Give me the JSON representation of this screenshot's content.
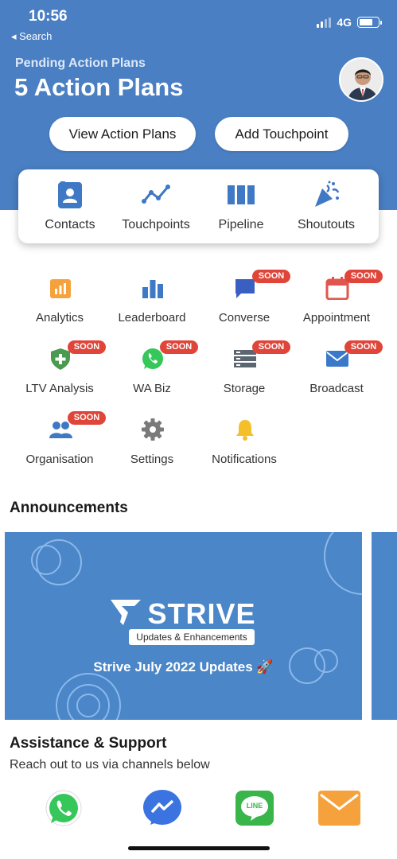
{
  "status_bar": {
    "time": "10:56",
    "back_label": "◂ Search",
    "network": "4G"
  },
  "header": {
    "pending_label": "Pending Action Plans",
    "pending_title": "5 Action Plans",
    "view_button": "View Action Plans",
    "add_button": "Add Touchpoint"
  },
  "quick_actions": [
    {
      "label": "Contacts",
      "icon": "contacts-icon"
    },
    {
      "label": "Touchpoints",
      "icon": "touchpoints-icon"
    },
    {
      "label": "Pipeline",
      "icon": "pipeline-icon"
    },
    {
      "label": "Shoutouts",
      "icon": "shoutouts-icon"
    }
  ],
  "soon_label": "SOON",
  "features": [
    {
      "label": "Analytics",
      "icon": "analytics-icon",
      "soon": false,
      "color": "#f5a23c"
    },
    {
      "label": "Leaderboard",
      "icon": "leaderboard-icon",
      "soon": false,
      "color": "#3f78c4"
    },
    {
      "label": "Converse",
      "icon": "converse-icon",
      "soon": true,
      "color": "#3a5fc2"
    },
    {
      "label": "Appointment",
      "icon": "calendar-icon",
      "soon": true,
      "color": "#e2554d"
    },
    {
      "label": "LTV Analysis",
      "icon": "shield-plus-icon",
      "soon": true,
      "color": "#4a9a4f"
    },
    {
      "label": "WA Biz",
      "icon": "whatsapp-icon",
      "soon": true,
      "color": "#35c759"
    },
    {
      "label": "Storage",
      "icon": "storage-icon",
      "soon": true,
      "color": "#5b6670"
    },
    {
      "label": "Broadcast",
      "icon": "mail-icon",
      "soon": true,
      "color": "#3a78c9"
    },
    {
      "label": "Organisation",
      "icon": "group-icon",
      "soon": true,
      "color": "#3f78c4"
    },
    {
      "label": "Settings",
      "icon": "gear-icon",
      "soon": false,
      "color": "#7a7a7a"
    },
    {
      "label": "Notifications",
      "icon": "bell-icon",
      "soon": false,
      "color": "#f5bf2a"
    }
  ],
  "announcements": {
    "title": "Announcements",
    "brand": "STRIVE",
    "brand_tag": "Updates & Enhancements",
    "caption": "Strive July 2022 Updates 🚀"
  },
  "support": {
    "title": "Assistance & Support",
    "subtitle": "Reach out to us via channels below",
    "channels": [
      "whatsapp-icon",
      "messenger-icon",
      "line-icon",
      "email-icon"
    ],
    "line_label": "LINE"
  },
  "colors": {
    "brand_blue": "#4a7fc3",
    "banner_blue": "#4a86c8",
    "soon_red": "#e0453a"
  }
}
